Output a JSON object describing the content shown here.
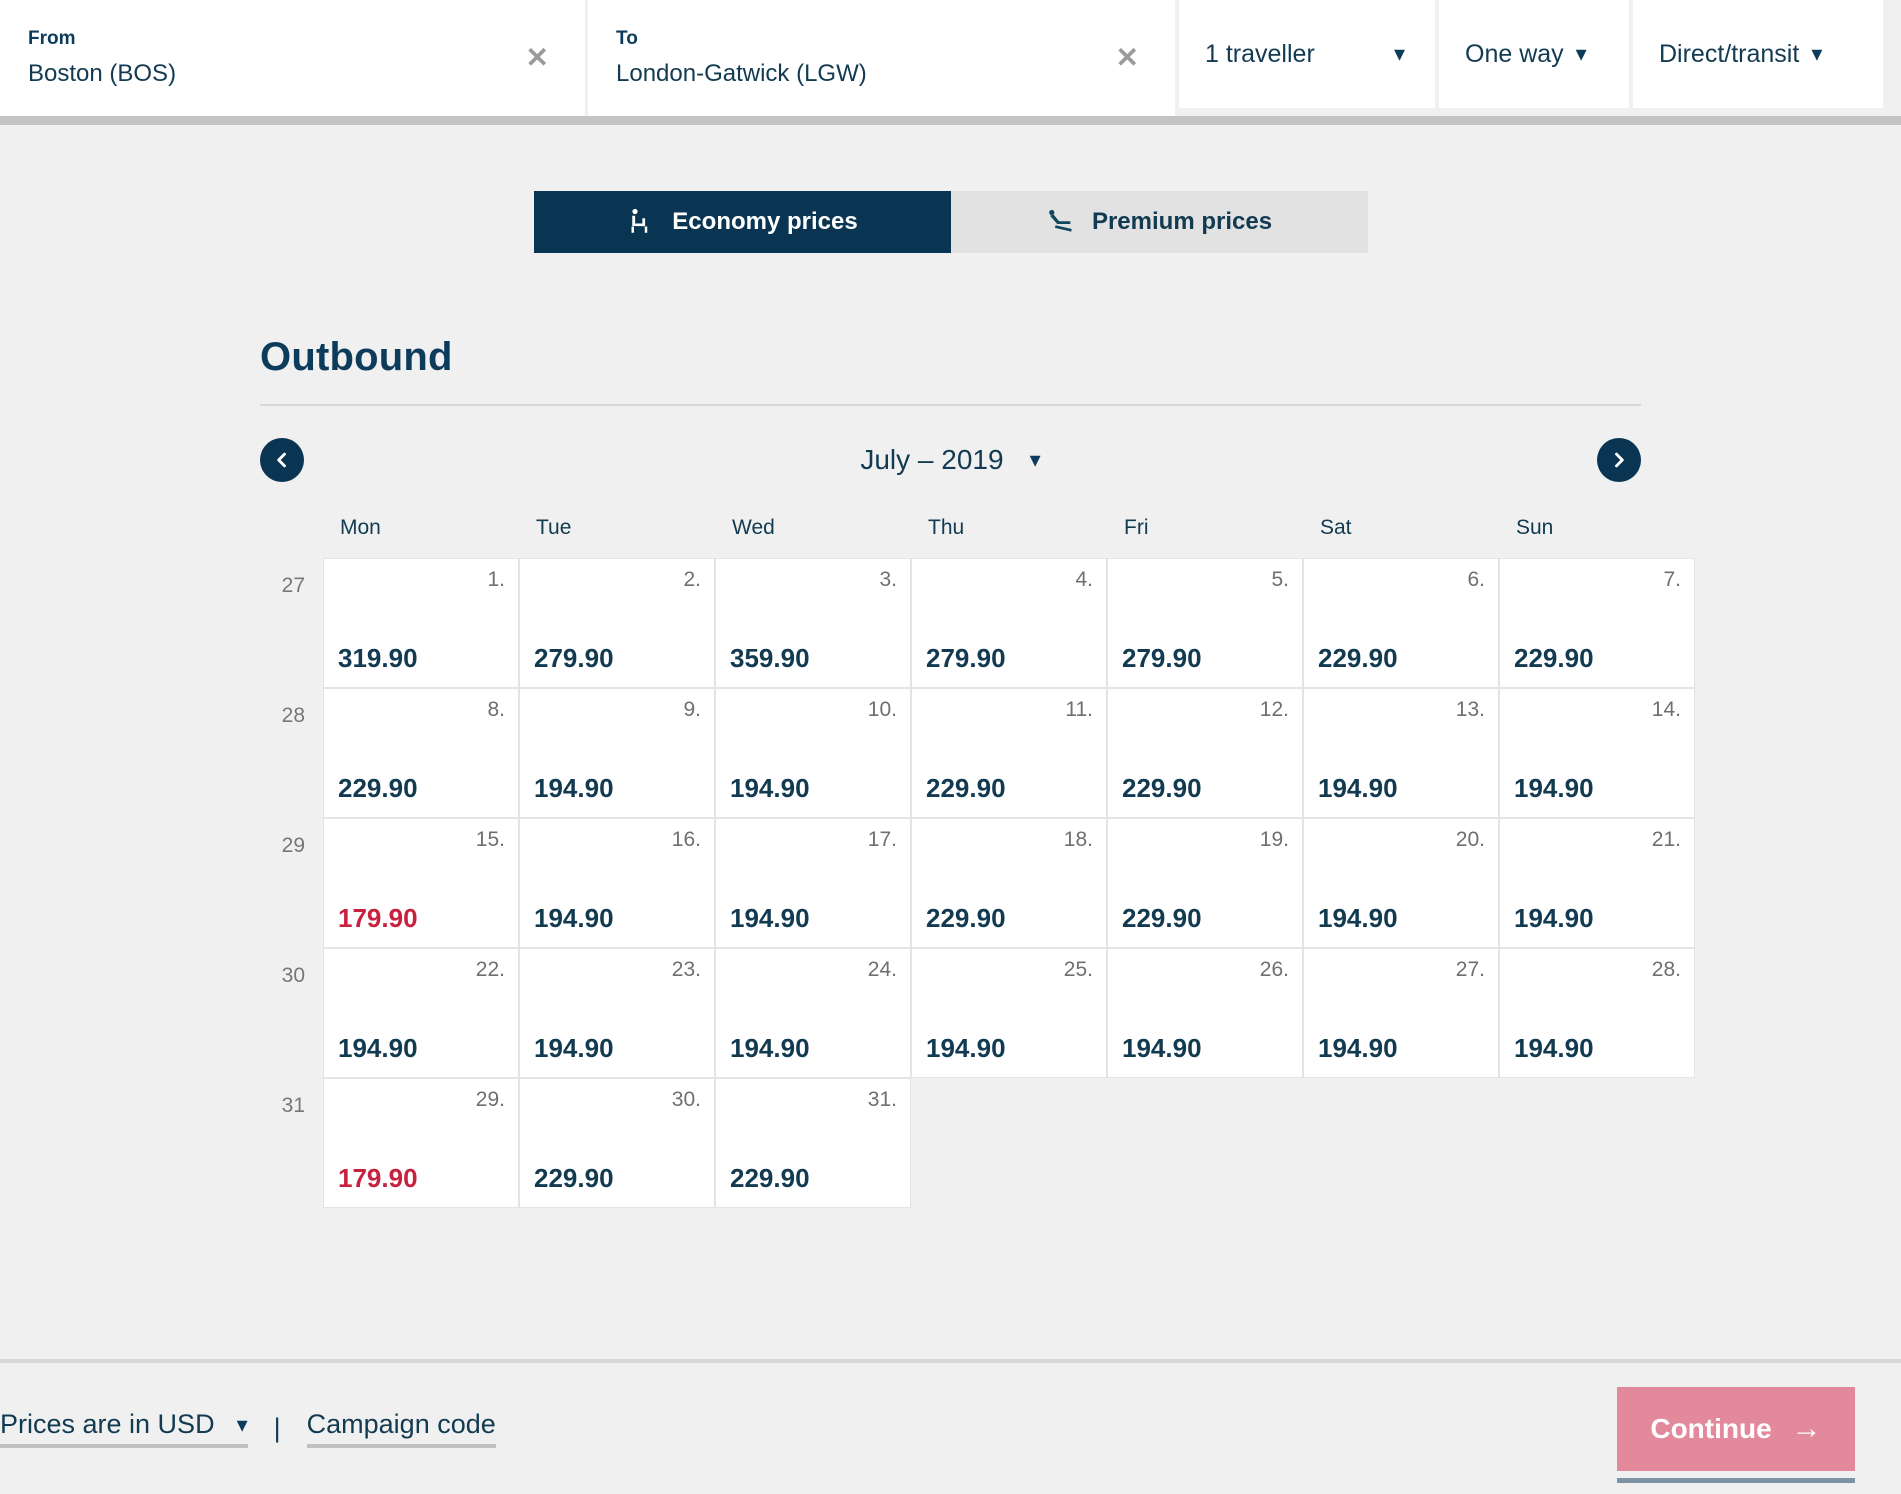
{
  "search": {
    "from": {
      "label": "From",
      "value": "Boston (BOS)",
      "clear": "✕"
    },
    "to": {
      "label": "To",
      "value": "London-Gatwick (LGW)",
      "clear": "✕"
    },
    "travellers": "1 traveller",
    "trip_type": "One way",
    "routing": "Direct/transit"
  },
  "tabs": [
    {
      "label": "Economy prices",
      "icon": "economy-seat-icon",
      "active": true
    },
    {
      "label": "Premium prices",
      "icon": "premium-seat-icon",
      "active": false
    }
  ],
  "section": {
    "title": "Outbound"
  },
  "month_nav": {
    "prev": "previous-month",
    "next": "next-month",
    "label": "July – 2019"
  },
  "calendar": {
    "weekday_headers": [
      "Mon",
      "Tue",
      "Wed",
      "Thu",
      "Fri",
      "Sat",
      "Sun"
    ],
    "week_numbers": [
      "27",
      "28",
      "29",
      "30",
      "31"
    ],
    "rows": [
      [
        {
          "date": "1.",
          "price": "319.90",
          "cheap": false
        },
        {
          "date": "2.",
          "price": "279.90",
          "cheap": false
        },
        {
          "date": "3.",
          "price": "359.90",
          "cheap": false
        },
        {
          "date": "4.",
          "price": "279.90",
          "cheap": false
        },
        {
          "date": "5.",
          "price": "279.90",
          "cheap": false
        },
        {
          "date": "6.",
          "price": "229.90",
          "cheap": false
        },
        {
          "date": "7.",
          "price": "229.90",
          "cheap": false
        }
      ],
      [
        {
          "date": "8.",
          "price": "229.90",
          "cheap": false
        },
        {
          "date": "9.",
          "price": "194.90",
          "cheap": false
        },
        {
          "date": "10.",
          "price": "194.90",
          "cheap": false
        },
        {
          "date": "11.",
          "price": "229.90",
          "cheap": false
        },
        {
          "date": "12.",
          "price": "229.90",
          "cheap": false
        },
        {
          "date": "13.",
          "price": "194.90",
          "cheap": false
        },
        {
          "date": "14.",
          "price": "194.90",
          "cheap": false
        }
      ],
      [
        {
          "date": "15.",
          "price": "179.90",
          "cheap": true
        },
        {
          "date": "16.",
          "price": "194.90",
          "cheap": false
        },
        {
          "date": "17.",
          "price": "194.90",
          "cheap": false
        },
        {
          "date": "18.",
          "price": "229.90",
          "cheap": false
        },
        {
          "date": "19.",
          "price": "229.90",
          "cheap": false
        },
        {
          "date": "20.",
          "price": "194.90",
          "cheap": false
        },
        {
          "date": "21.",
          "price": "194.90",
          "cheap": false
        }
      ],
      [
        {
          "date": "22.",
          "price": "194.90",
          "cheap": false
        },
        {
          "date": "23.",
          "price": "194.90",
          "cheap": false
        },
        {
          "date": "24.",
          "price": "194.90",
          "cheap": false
        },
        {
          "date": "25.",
          "price": "194.90",
          "cheap": false
        },
        {
          "date": "26.",
          "price": "194.90",
          "cheap": false
        },
        {
          "date": "27.",
          "price": "194.90",
          "cheap": false
        },
        {
          "date": "28.",
          "price": "194.90",
          "cheap": false
        }
      ],
      [
        {
          "date": "29.",
          "price": "179.90",
          "cheap": true
        },
        {
          "date": "30.",
          "price": "229.90",
          "cheap": false
        },
        {
          "date": "31.",
          "price": "229.90",
          "cheap": false
        },
        null,
        null,
        null,
        null
      ]
    ]
  },
  "footer": {
    "currency_text": "Prices are in USD",
    "separator": "|",
    "campaign_code": "Campaign code",
    "continue_label": "Continue",
    "continue_arrow": "→"
  },
  "colors": {
    "brand_navy": "#0a3552",
    "text_navy": "#123a51",
    "cheap_price": "#c8213f",
    "continue_pink": "#e3899c",
    "page_bg": "#f0f0f0"
  }
}
